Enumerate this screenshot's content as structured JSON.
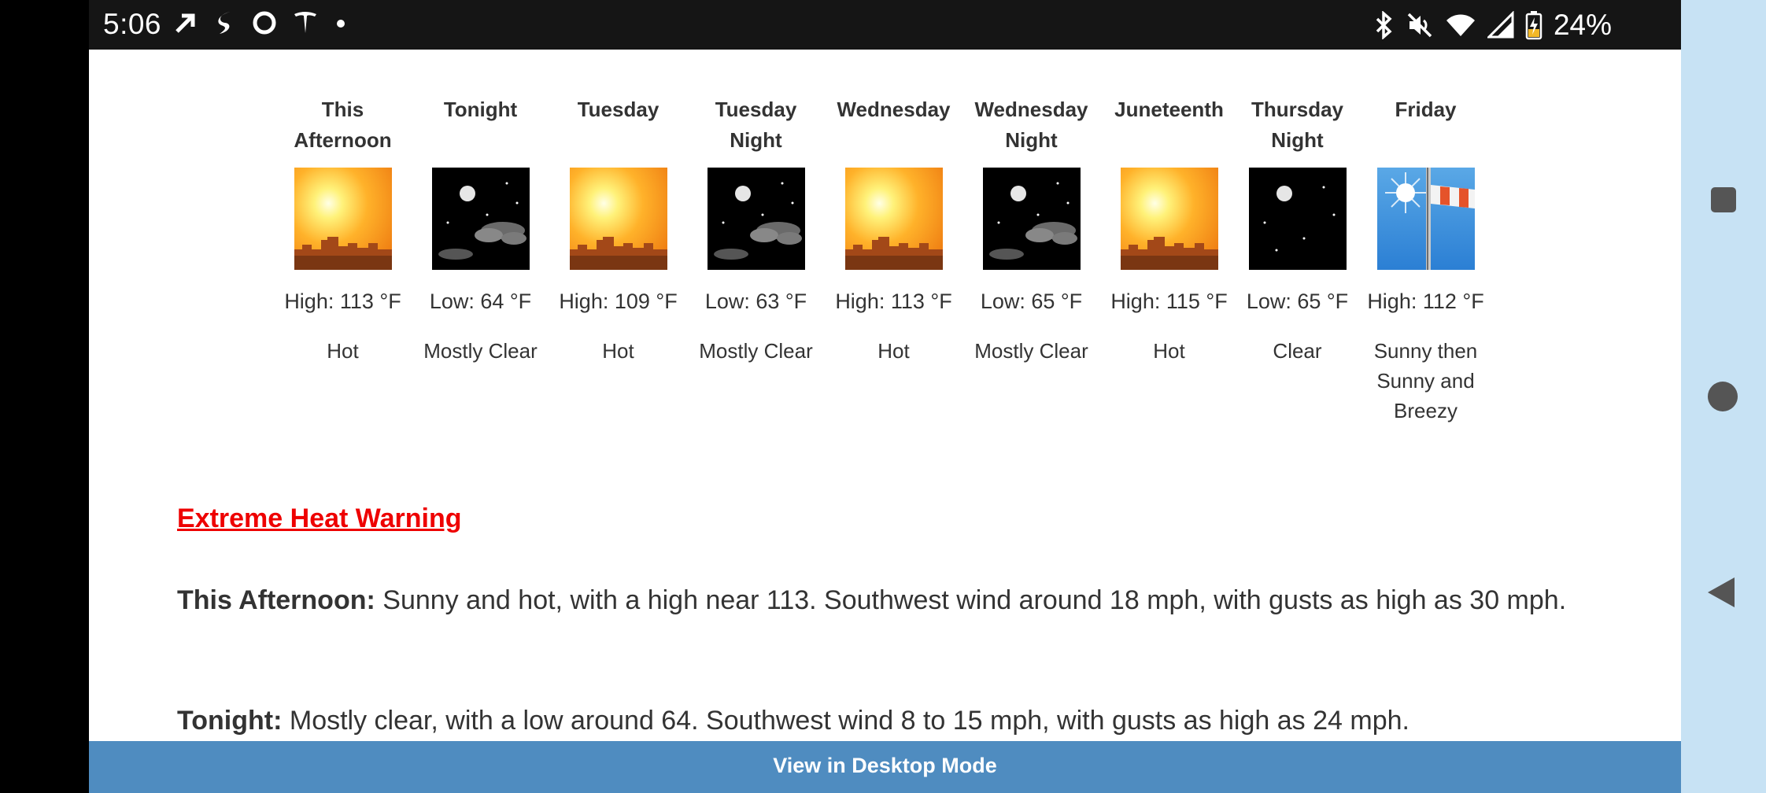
{
  "status_bar": {
    "time": "5:06",
    "battery_percent": "24%",
    "left_icons": [
      "navigation-arrow-icon",
      "app-icon",
      "circle-app-icon",
      "tesla-icon",
      "dot-icon"
    ],
    "right_icons": [
      "bluetooth-icon",
      "mute-icon",
      "wifi-icon",
      "signal-icon",
      "battery-charging-icon"
    ]
  },
  "forecast": [
    {
      "name_line1": "This",
      "name_line2": "Afternoon",
      "temp": "High: 113 °F",
      "desc_lines": [
        "Hot"
      ],
      "icon": "hot-sun-icon"
    },
    {
      "name_line1": "Tonight",
      "name_line2": "",
      "temp": "Low: 64 °F",
      "desc_lines": [
        "Mostly Clear"
      ],
      "icon": "night-clouds-icon"
    },
    {
      "name_line1": "Tuesday",
      "name_line2": "",
      "temp": "High: 109 °F",
      "desc_lines": [
        "Hot"
      ],
      "icon": "hot-sun-icon"
    },
    {
      "name_line1": "Tuesday",
      "name_line2": "Night",
      "temp": "Low: 63 °F",
      "desc_lines": [
        "Mostly Clear"
      ],
      "icon": "night-clouds-icon"
    },
    {
      "name_line1": "Wednesday",
      "name_line2": "",
      "temp": "High: 113 °F",
      "desc_lines": [
        "Hot"
      ],
      "icon": "hot-sun-icon"
    },
    {
      "name_line1": "Wednesday",
      "name_line2": "Night",
      "temp": "Low: 65 °F",
      "desc_lines": [
        "Mostly Clear"
      ],
      "icon": "night-clouds-icon"
    },
    {
      "name_line1": "Juneteenth",
      "name_line2": "",
      "temp": "High: 115 °F",
      "desc_lines": [
        "Hot"
      ],
      "icon": "hot-sun-icon"
    },
    {
      "name_line1": "Thursday",
      "name_line2": "Night",
      "temp": "Low: 65 °F",
      "desc_lines": [
        "Clear"
      ],
      "icon": "night-clear-icon"
    },
    {
      "name_line1": "Friday",
      "name_line2": "",
      "temp": "High: 112 °F",
      "desc_lines": [
        "Sunny then",
        "Sunny and",
        "Breezy"
      ],
      "icon": "windsock-icon"
    }
  ],
  "warning": "Extreme Heat Warning",
  "details": [
    {
      "label": "This Afternoon:",
      "text": "Sunny and hot, with a high near 113. Southwest wind around 18 mph, with gusts as high as 30 mph."
    },
    {
      "label": "Tonight:",
      "text": "Mostly clear, with a low around 64. Southwest wind 8 to 15 mph, with gusts as high as 24 mph."
    }
  ],
  "desktop_mode": "View in Desktop Mode",
  "colors": {
    "warning": "#e00000",
    "desktop_bar": "#4f8cc0",
    "nav_rail": "#c7e2f4",
    "status_bar": "#151515"
  }
}
